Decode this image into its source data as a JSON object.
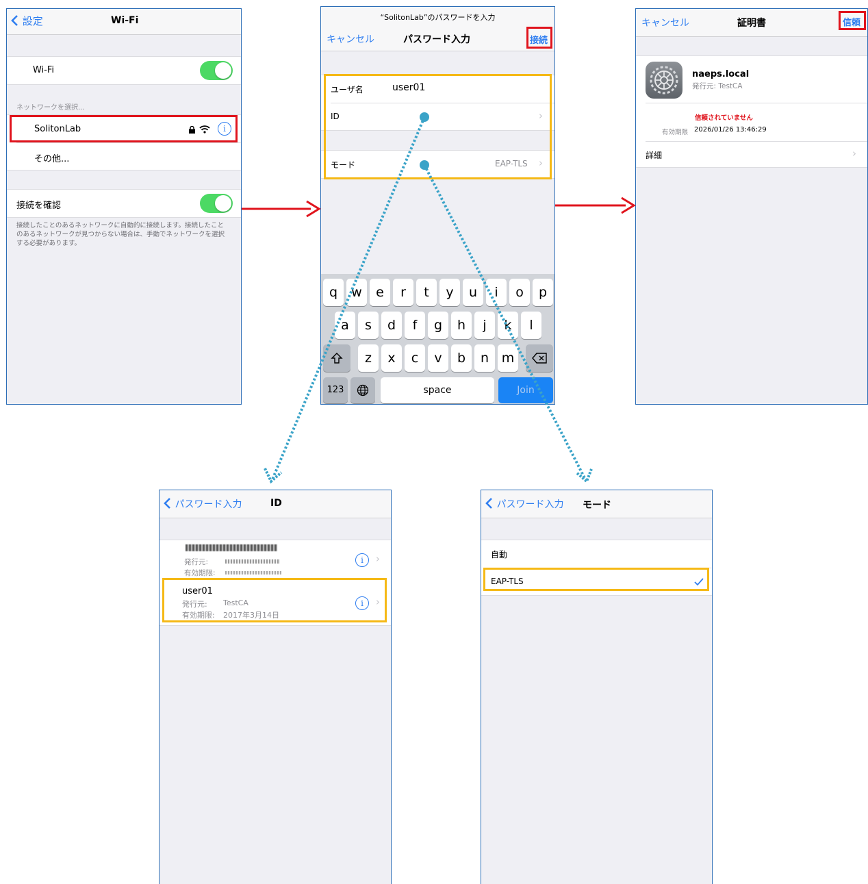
{
  "wifi_screen": {
    "back_label": "設定",
    "title": "Wi-Fi",
    "wifi_label": "Wi-Fi",
    "network_section_header": "ネットワークを選択...",
    "network_name": "SolitonLab",
    "other_label": "その他...",
    "ask_to_join_label": "接続を確認",
    "footer_text": "接続したことのあるネットワークに自動的に接続します。接続したことのあるネットワークが見つからない場合は、手動でネットワークを選択する必要があります。"
  },
  "password_screen": {
    "prompt": "“SolitonLab”のパスワードを入力",
    "cancel_label": "キャンセル",
    "title": "パスワード入力",
    "join_label": "接続",
    "username_label": "ユーザ名",
    "username_value": "user01",
    "id_label": "ID",
    "mode_label": "モード",
    "mode_value": "EAP-TLS",
    "keyboard": {
      "row1": [
        "q",
        "w",
        "e",
        "r",
        "t",
        "y",
        "u",
        "i",
        "o",
        "p"
      ],
      "row2": [
        "a",
        "s",
        "d",
        "f",
        "g",
        "h",
        "j",
        "k",
        "l"
      ],
      "row3": [
        "z",
        "x",
        "c",
        "v",
        "b",
        "n",
        "m"
      ],
      "numbers_key": "123",
      "space_key": "space",
      "join_key": "Join"
    }
  },
  "certificate_screen": {
    "cancel_label": "キャンセル",
    "title": "証明書",
    "trust_label": "信頼",
    "cert_name": "naeps.local",
    "issuer_line": "発行元: TestCA",
    "not_trusted": "信頼されていません",
    "expires_label": "有効期限",
    "expires_value": "2026/01/26 13:46:29",
    "details_label": "詳細"
  },
  "id_screen": {
    "back_label": "パスワード入力",
    "title": "ID",
    "entry_selected": {
      "name": "user01",
      "issuer_label": "発行元:",
      "issuer_value": "TestCA",
      "expires_label": "有効期限:",
      "expires_value": "2017年3月14日"
    },
    "entry_blurred": {
      "issuer_label": "発行元:",
      "expires_label": "有効期限:"
    }
  },
  "mode_screen": {
    "back_label": "パスワード入力",
    "title": "モード",
    "option_auto": "自動",
    "option_eap_tls": "EAP-TLS"
  },
  "colors": {
    "ios_blue": "#2f7ef0",
    "highlight_red": "#e0141d",
    "highlight_yellow": "#f5b916",
    "arrow_red": "#e0141d",
    "dotted_connector": "#3aa3c8",
    "toggle_green": "#4cd964"
  }
}
